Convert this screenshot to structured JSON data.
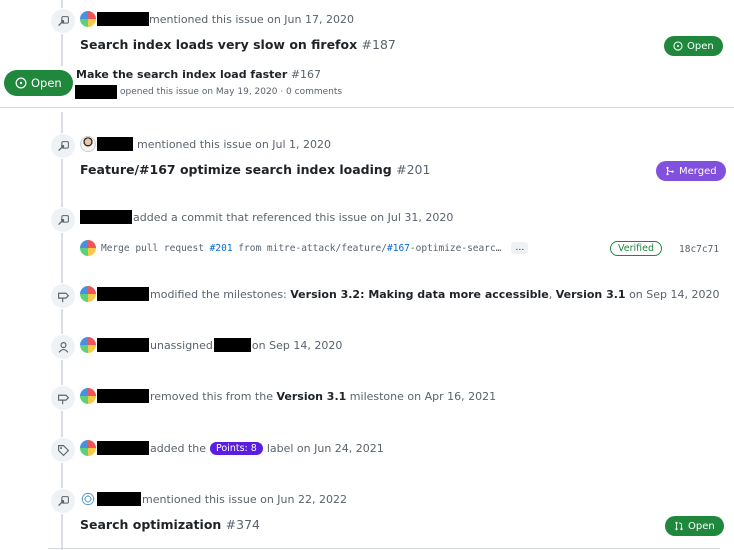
{
  "events": {
    "e1": {
      "action": "mentioned this issue on Jun 17, 2020",
      "title": "Search index loads very slow on firefox",
      "number": "#187",
      "state": "Open"
    },
    "e2": {
      "state": "Open",
      "title": "Make the search index load faster",
      "number": "#167",
      "meta": "opened this issue on May 19, 2020 · 0 comments"
    },
    "e3": {
      "action": "mentioned this issue on Jul 1, 2020",
      "title": "Feature/#167 optimize search index loading",
      "number": "#201",
      "state": "Merged"
    },
    "e4": {
      "action": "added a commit that referenced this issue on Jul 31, 2020",
      "commit_prefix": "Merge pull request ",
      "commit_link1": "#201",
      "commit_mid": " from mitre-attack/feature/",
      "commit_link2": "#167",
      "commit_suffix": "-optimize-searc…",
      "ellipsis": "…",
      "verified": "Verified",
      "sha": "18c7c71"
    },
    "e5": {
      "action": "modified the milestones:",
      "m1": "Version 3.2: Making data more accessible",
      "comma": ",",
      "m2": "Version 3.1",
      "date": "on Sep 14, 2020"
    },
    "e6": {
      "action": "unassigned",
      "date": "on Sep 14, 2020"
    },
    "e7": {
      "action": "removed this from the",
      "milestone": "Version 3.1",
      "date": "milestone on Apr 16, 2021"
    },
    "e8": {
      "action": "added the",
      "label": "Points: 8",
      "date": "label on Jun 24, 2021"
    },
    "e9": {
      "action": "mentioned this issue on Jun 22, 2022",
      "title": "Search optimization",
      "number": "#374",
      "state": "Open"
    }
  },
  "icons": [
    "cross-reference-icon",
    "person-icon",
    "milestone-icon",
    "tag-icon",
    "issue-open-icon",
    "pr-merged-icon",
    "pr-open-icon"
  ],
  "colors": {
    "open": "#1f883d",
    "merged": "#8250df",
    "label": "#5a1ee0",
    "link": "#0969da"
  }
}
